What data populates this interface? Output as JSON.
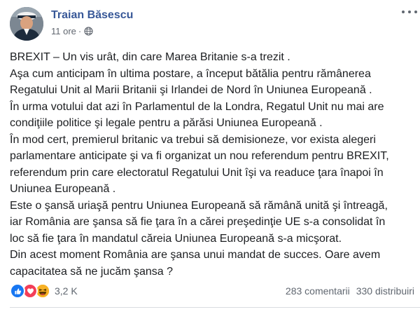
{
  "post": {
    "author": "Traian Băsescu",
    "time": "11 ore",
    "separator": "·",
    "privacy_icon": "globe-icon",
    "lines": [
      "BREXIT – Un vis urât, din care Marea Britanie s-a trezit .",
      "Aşa cum anticipam în ultima postare, a început bătălia pentru rămânerea",
      "Regatului Unit al Marii Britanii şi Irlandei de Nord în Uniunea Europeană .",
      "În urma votului dat azi în Parlamentul de la Londra, Regatul Unit nu mai are",
      "condiţiile politice şi legale pentru a părăsi Uniunea Europeană .",
      "În mod cert, premierul britanic va trebui să demisioneze, vor exista alegeri",
      "parlamentare anticipate şi va fi organizat un nou referendum pentru BREXIT,",
      "referendum prin care electoratul Regatului Unit îşi va readuce ţara înapoi în",
      "Uniunea Europeană .",
      "Este o şansă uriaşă pentru Uniunea Europeană să rămână unită şi întreagă,",
      "iar România are şansa să fie ţara în a cărei preşedinţie UE s-a consolidat în",
      "loc să fie ţara în mandatul căreia Uniunea Europeană s-a micşorat.",
      "Din acest moment România are şansa unui mandat de succes. Oare avem",
      "capacitatea să ne jucăm şansa ?"
    ]
  },
  "footer": {
    "reaction_icons": [
      "like-icon",
      "love-icon",
      "haha-icon"
    ],
    "reactions_count": "3,2 K",
    "comments": "283 comentarii",
    "shares": "330 distribuiri"
  },
  "colors": {
    "author_link": "#385898",
    "meta_text": "#616770",
    "like_blue": "#1877f2",
    "love_red": "#f33e58",
    "haha_yellow": "#f7b125"
  }
}
